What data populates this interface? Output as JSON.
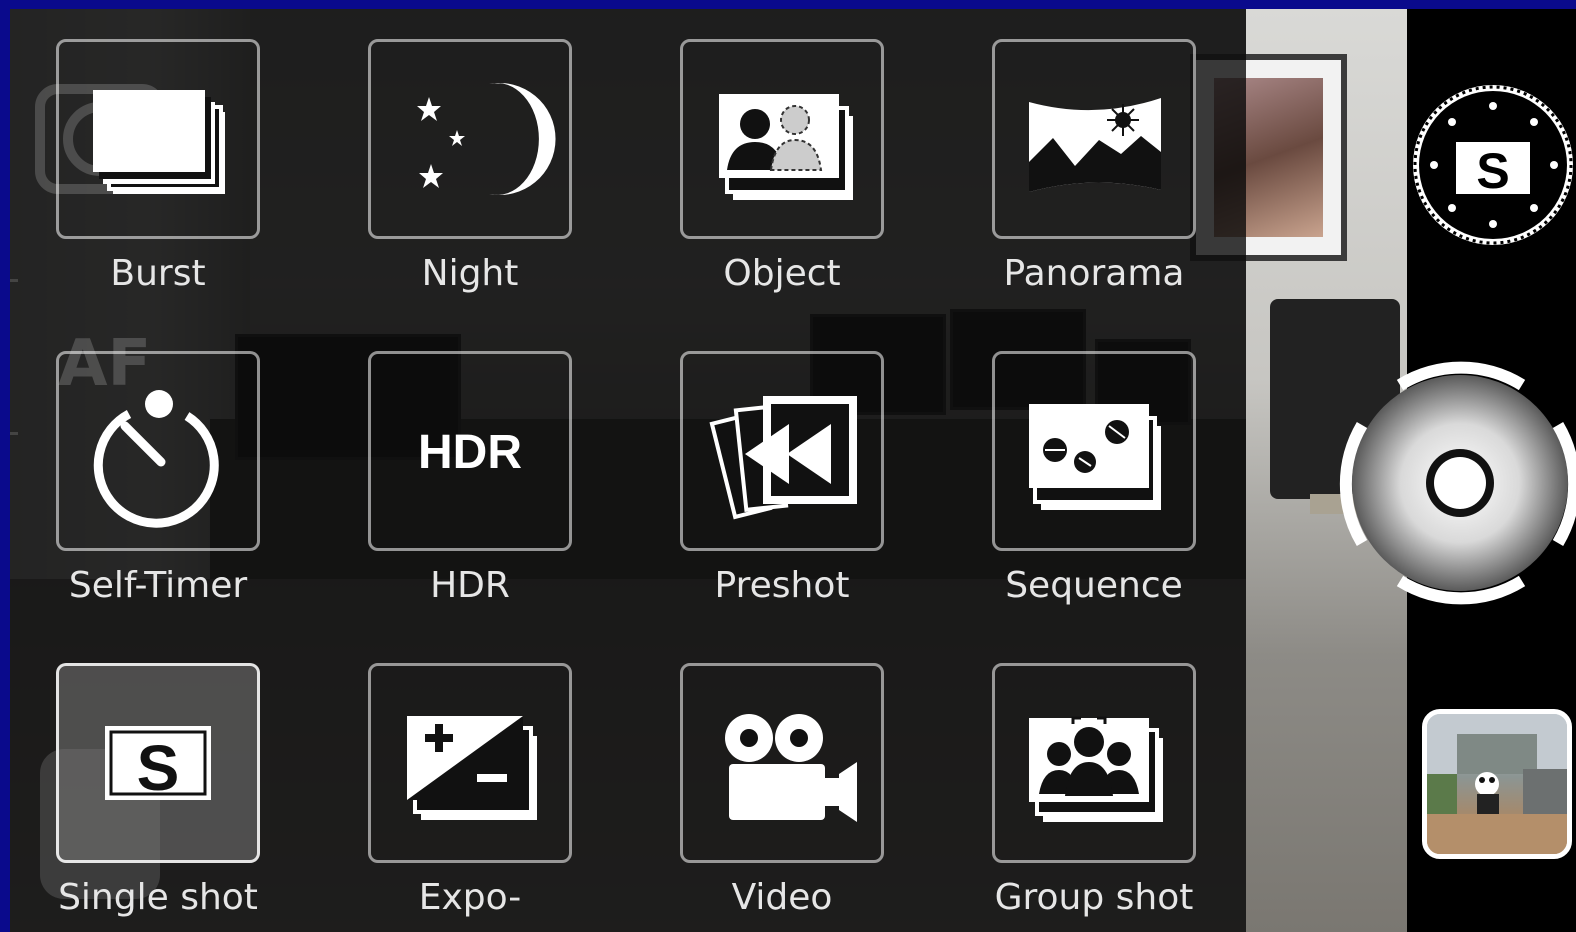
{
  "modes": [
    {
      "label": "Burst",
      "icon": "burst-icon",
      "selected": false
    },
    {
      "label": "Night",
      "icon": "night-moon-stars-icon",
      "selected": false
    },
    {
      "label": "Object",
      "icon": "object-remove-icon",
      "selected": false
    },
    {
      "label": "Panorama",
      "icon": "panorama-icon",
      "selected": false
    },
    {
      "label": "Self-Timer",
      "icon": "self-timer-icon",
      "selected": false
    },
    {
      "label": "HDR",
      "icon": "hdr-icon",
      "icon_text": "HDR",
      "selected": false
    },
    {
      "label": "Preshot",
      "icon": "preshot-icon",
      "selected": false
    },
    {
      "label": "Sequence",
      "icon": "sequence-icon",
      "selected": false
    },
    {
      "label": "Single shot",
      "icon": "single-shot-icon",
      "icon_text": "S",
      "selected": true
    },
    {
      "label": "Expo-",
      "icon": "exposure-bracketing-icon",
      "selected": false
    },
    {
      "label": "Video",
      "icon": "video-camera-icon",
      "selected": false
    },
    {
      "label": "Group shot",
      "icon": "group-shot-icon",
      "selected": false
    }
  ],
  "controls": {
    "mode_dial_letter": "S",
    "ghost_af": "AF"
  },
  "colors": {
    "frame": "#0a0a8c",
    "accent": "#ffffff"
  }
}
